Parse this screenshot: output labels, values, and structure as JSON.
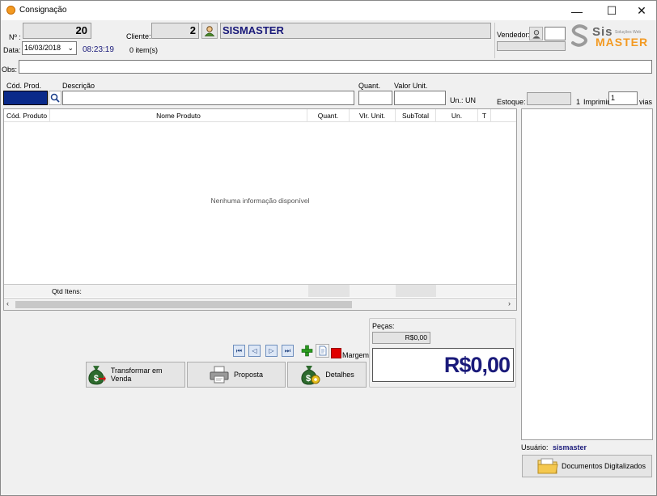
{
  "window": {
    "title": "Consignação",
    "minimize": "—",
    "maximize": "☐",
    "close": "✕"
  },
  "header": {
    "numero_label": "Nº :",
    "numero_value": "20",
    "data_label": "Data:",
    "data_value": "16/03/2018",
    "hora_value": "08:23:19",
    "itens_count": "0 item(s)",
    "cliente_label": "Cliente:",
    "cliente_id": "2",
    "cliente_nome": "SISMASTER",
    "vendedor_label": "Vendedor:",
    "vendedor_value": ""
  },
  "logo": {
    "text_top": "Sis",
    "text_bottom": "MASTER",
    "tagline": "Soluções Web"
  },
  "obs": {
    "label": "Obs:",
    "value": ""
  },
  "entry": {
    "cod_label": "Cód. Prod.",
    "desc_label": "Descrição",
    "quant_label": "Quant.",
    "valor_label": "Valor Unit.",
    "un_label": "Un.: UN",
    "estoque_label": "Estoque:",
    "qty_suffix": "1",
    "imprimir_label": "Imprimir",
    "imprimir_value": "1",
    "vias_label": "vias"
  },
  "grid": {
    "columns": [
      "Cód. Produto",
      "Nome Produto",
      "Quant.",
      "Vlr. Unit.",
      "SubTotal",
      "Un.",
      "T"
    ],
    "empty_message": "Nenhuma informação disponível",
    "footer_label": "Qtd Itens:"
  },
  "totals": {
    "pecas_label": "Peças:",
    "pecas_value": "R$0,00",
    "total_value": "R$0,00",
    "margem_label": "Margem"
  },
  "buttons": {
    "transformar": "Transformar em Venda",
    "proposta": "Proposta",
    "detalhes": "Detalhes",
    "documentos": "Documentos Digitalizados"
  },
  "usuario": {
    "label": "Usuário:",
    "value": "sismaster"
  },
  "colors": {
    "accent_navy": "#1a1a7a",
    "margem_red": "#e00000",
    "logo_orange": "#f39a22"
  }
}
